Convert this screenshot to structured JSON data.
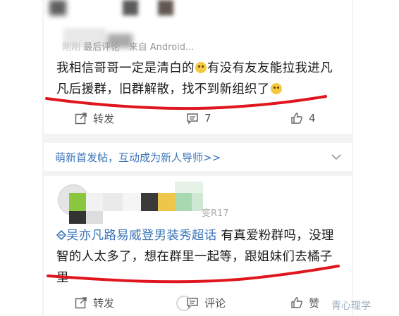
{
  "post1": {
    "meta_time": "刚刚",
    "meta_last_comment": "最后评论",
    "meta_source": "来自 Android...",
    "text_part1": "我相信哥哥一定是清白的",
    "text_part2": "有没有友友能拉我进凡凡后援群，旧群解散，找不到新组织了",
    "actions": {
      "repost": "转发",
      "comment_count": "7",
      "like_count": "4"
    }
  },
  "banner": {
    "text": "萌新首发帖，互动成为新人导师>>"
  },
  "post2": {
    "meta_fragment": "变R17",
    "topic": "吴亦凡路易威登男装秀超话",
    "text": "有真爱粉群吗，没理智的人太多了，想在群里一起等，跟姐妹们去橘子里",
    "actions": {
      "repost": "转发",
      "comment": "评论",
      "like": "赞"
    }
  },
  "watermark": "青心理学",
  "colors": {
    "link": "#3b74b8",
    "redline": "#e0161e",
    "background": "#f3f3f3"
  },
  "icons": [
    "repost-icon",
    "comment-icon",
    "like-icon",
    "chevron-down-icon",
    "topic-diamond-icon",
    "crying-emoji-icon"
  ]
}
